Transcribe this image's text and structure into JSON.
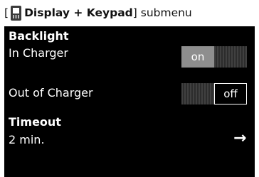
{
  "caption": {
    "open_bracket": "[",
    "icon": "handset-icon",
    "title_bold": "Display + Keypad",
    "close_bracket": "]",
    "suffix": " submenu"
  },
  "screen": {
    "backlight": {
      "heading": "Backlight",
      "in_charger": {
        "label": "In Charger",
        "state": "on",
        "on_label": "on"
      },
      "out_of_charger": {
        "label": "Out of Charger",
        "state": "off",
        "off_label": "off"
      }
    },
    "timeout": {
      "heading": "Timeout",
      "value": "2 min.",
      "arrow": "→",
      "arrow_icon": "right-arrow-icon"
    }
  },
  "colors": {
    "screen_background": "#000000",
    "active_segment": "#8e8e8e",
    "text": "#ffffff"
  }
}
